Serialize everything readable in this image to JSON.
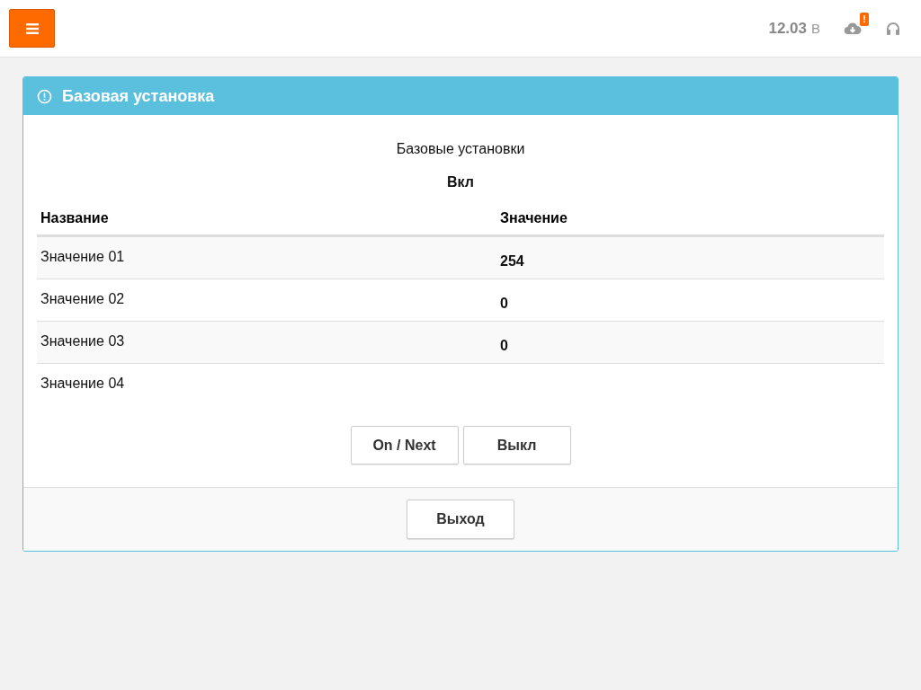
{
  "topbar": {
    "voltage": "12.03",
    "voltage_unit": "В",
    "cloud_badge": "!"
  },
  "panel": {
    "title": "Базовая установка",
    "subtitle": "Базовые установки",
    "state": "Вкл",
    "table": {
      "columns": [
        "Название",
        "Значение"
      ],
      "rows": [
        {
          "name": "Значение 01",
          "value": "254"
        },
        {
          "name": "Значение 02",
          "value": "0"
        },
        {
          "name": "Значение 03",
          "value": "0"
        },
        {
          "name": "Значение 04"
        }
      ]
    },
    "buttons": [
      "On / Next",
      "Выкл"
    ],
    "footer_button": "Выход"
  }
}
